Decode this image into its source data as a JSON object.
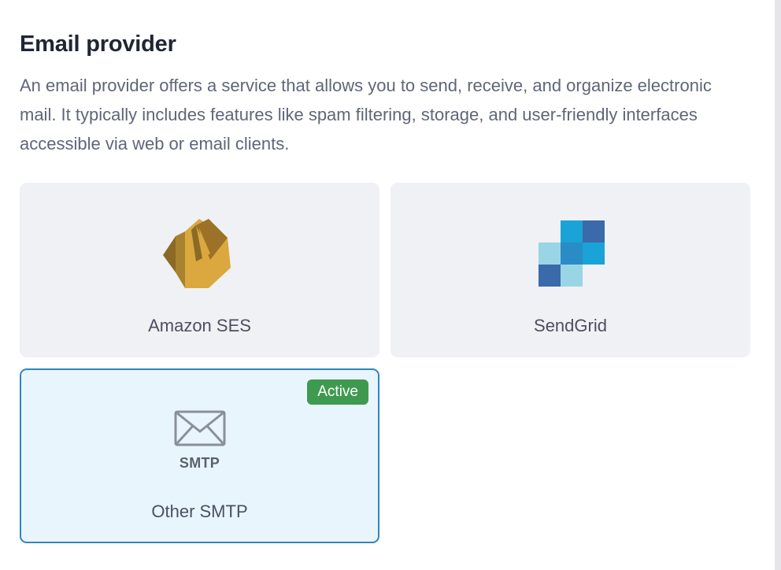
{
  "section": {
    "title": "Email provider",
    "description": "An email provider offers a service that allows you to send, receive, and organize electronic mail. It typically includes features like spam filtering, storage, and user-friendly interfaces accessible via web or email clients."
  },
  "providers": [
    {
      "label": "Amazon SES",
      "icon": "amazon-ses-logo",
      "active": false
    },
    {
      "label": "SendGrid",
      "icon": "sendgrid-logo",
      "active": false
    },
    {
      "label": "Other SMTP",
      "icon": "envelope-icon",
      "logo_text": "SMTP",
      "active": true,
      "badge": "Active"
    }
  ],
  "colors": {
    "card_bg": "#f0f1f5",
    "active_card_bg": "#e9f5fd",
    "active_border": "#2f86c0",
    "badge_bg": "#3f9a4f"
  }
}
